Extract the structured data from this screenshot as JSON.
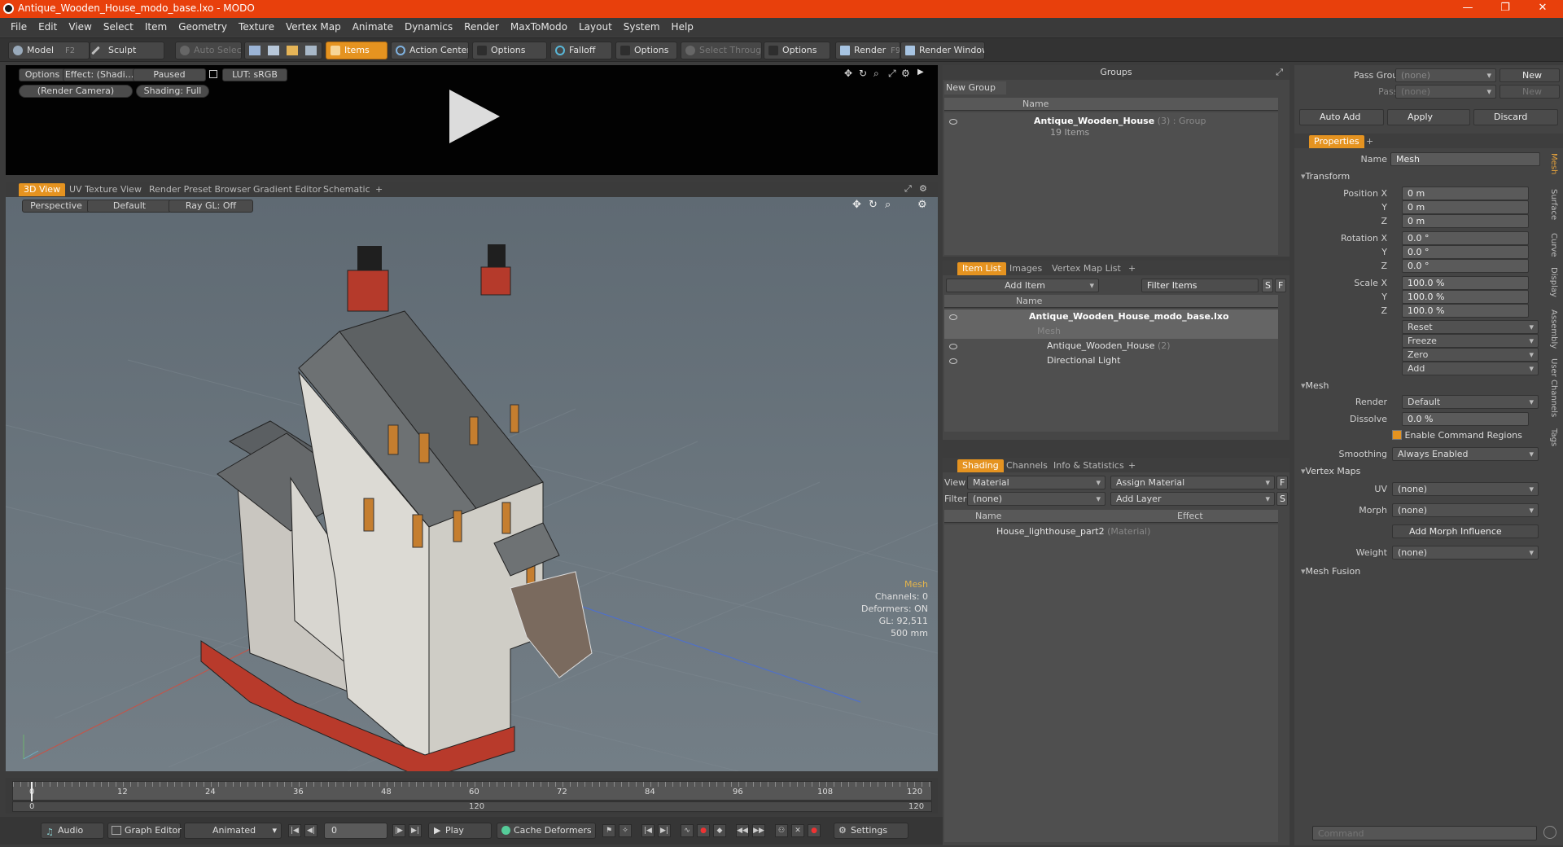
{
  "window": {
    "title": "Antique_Wooden_House_modo_base.lxo - MODO",
    "min": "—",
    "max": "❐",
    "close": "✕"
  },
  "menu": [
    "File",
    "Edit",
    "View",
    "Select",
    "Item",
    "Geometry",
    "Texture",
    "Vertex Map",
    "Animate",
    "Dynamics",
    "Render",
    "MaxToModo",
    "Layout",
    "System",
    "Help"
  ],
  "toolbar": {
    "model": "Model",
    "model_key": "F2",
    "sculpt": "Sculpt",
    "auto_select": "Auto Select",
    "items": "Items",
    "action_center": "Action Center",
    "options1": "Options",
    "falloff": "Falloff",
    "options2": "Options",
    "select_through": "Select Through",
    "options3": "Options",
    "render": "Render",
    "render_key": "F9",
    "render_window": "Render Window"
  },
  "preview": {
    "options": "Options",
    "effect": "Effect: (Shadi...",
    "paused": "Paused",
    "lut": "LUT: sRGB",
    "camera": "(Render Camera)",
    "shading": "Shading: Full"
  },
  "viewport_tabs": [
    "3D View",
    "UV Texture View",
    "Render Preset Browser",
    "Gradient Editor",
    "Schematic"
  ],
  "viewport": {
    "perspective": "Perspective",
    "default": "Default",
    "raygl": "Ray GL: Off",
    "info": {
      "mesh": "Mesh",
      "channels": "Channels: 0",
      "deformers": "Deformers: ON",
      "gl": "GL: 92,511",
      "scale": "500 mm"
    }
  },
  "timeline": {
    "ticks": [
      "0",
      "12",
      "24",
      "36",
      "48",
      "60",
      "72",
      "84",
      "96",
      "108",
      "120"
    ],
    "sub_start": "0",
    "sub_mid": "120",
    "sub_end": "120"
  },
  "bottombar": {
    "audio": "Audio",
    "graph_editor": "Graph Editor",
    "animated": "Animated",
    "frame": "0",
    "play": "Play",
    "cache": "Cache Deformers",
    "settings": "Settings"
  },
  "groups": {
    "header": "Groups",
    "new_group": "New Group",
    "col_name": "Name",
    "group_name": "Antique_Wooden_House",
    "group_count": "(3)",
    "group_type": ": Group",
    "group_items": "19 Items"
  },
  "itemlist": {
    "tabs": [
      "Item List",
      "Images",
      "Vertex Map List"
    ],
    "add_item": "Add Item",
    "filter": "Filter Items",
    "s": "S",
    "f": "F",
    "col_name": "Name",
    "scene": "Antique_Wooden_House_modo_base.lxo",
    "mesh": "Mesh",
    "house": "Antique_Wooden_House",
    "house_count": "(2)",
    "light": "Directional Light"
  },
  "shading": {
    "tabs": [
      "Shading",
      "Channels",
      "Info & Statistics"
    ],
    "view_label": "View",
    "view_value": "Material",
    "assign": "Assign Material",
    "f": "F",
    "filter_label": "Filter",
    "filter_value": "(none)",
    "add_layer": "Add Layer",
    "s": "S",
    "col_name": "Name",
    "col_effect": "Effect",
    "material": "House_lighthouse_part2",
    "material_type": "(Material)"
  },
  "passes": {
    "pass_groups": "Pass Groups",
    "pass_value": "(none)",
    "new1": "New",
    "passes": "Passes",
    "passes_value": "(none)",
    "new2": "New"
  },
  "actions": {
    "auto_add": "Auto Add",
    "apply": "Apply",
    "discard": "Discard"
  },
  "properties": {
    "tab": "Properties",
    "name_label": "Name",
    "name_value": "Mesh",
    "transform": "Transform",
    "position_label": "Position X",
    "pos_x": "0 m",
    "pos_y": "0 m",
    "pos_z": "0 m",
    "rotation_label": "Rotation X",
    "rot_x": "0.0 °",
    "rot_y": "0.0 °",
    "rot_z": "0.0 °",
    "scale_label": "Scale X",
    "scl_x": "100.0 %",
    "scl_y": "100.0 %",
    "scl_z": "100.0 %",
    "y": "Y",
    "z": "Z",
    "reset": "Reset",
    "freeze": "Freeze",
    "zero": "Zero",
    "add": "Add",
    "mesh": "Mesh",
    "render_label": "Render",
    "render_value": "Default",
    "dissolve_label": "Dissolve",
    "dissolve_value": "0.0 %",
    "enable_regions": "Enable Command Regions",
    "smoothing_label": "Smoothing",
    "smoothing_value": "Always Enabled",
    "vertex_maps": "Vertex Maps",
    "uv_label": "UV",
    "uv_value": "(none)",
    "morph_label": "Morph",
    "morph_value": "(none)",
    "add_morph": "Add Morph Influence",
    "weight_label": "Weight",
    "weight_value": "(none)",
    "mesh_fusion": "Mesh Fusion"
  },
  "side_tabs": [
    "Mesh",
    "Surface",
    "Curve",
    "Display",
    "Assembly",
    "User Channels",
    "Tags"
  ],
  "command": {
    "placeholder": "Command"
  }
}
